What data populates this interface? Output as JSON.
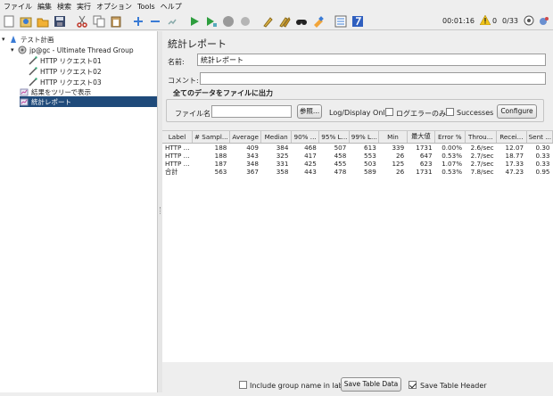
{
  "menubar": [
    "ファイル",
    "編集",
    "検索",
    "実行",
    "オプション",
    "Tools",
    "ヘルプ"
  ],
  "toolbar": {
    "icons": [
      "new-icon",
      "templates-icon",
      "open-icon",
      "save-icon",
      "cut-icon",
      "copy-icon",
      "paste-icon",
      "expand-icon",
      "collapse-icon",
      "toggle-icon",
      "start-icon",
      "start-no-pause-icon",
      "stop-icon",
      "shutdown-icon",
      "clear-icon",
      "clear-all-icon",
      "search-icon",
      "reset-search-icon",
      "function-helper-icon",
      "help-icon"
    ],
    "timer": "00:01:16",
    "warning_count": "0",
    "threads": "0/33"
  },
  "tree": {
    "items": [
      {
        "label": "テスト計画",
        "icon": "test-plan-icon",
        "level": 0,
        "expander": "▾"
      },
      {
        "label": "jp@gc - Ultimate Thread Group",
        "icon": "thread-group-icon",
        "level": 1,
        "expander": "▾"
      },
      {
        "label": "HTTP リクエスト01",
        "icon": "sampler-icon",
        "level": 2
      },
      {
        "label": "HTTP リクエスト02",
        "icon": "sampler-icon",
        "level": 2
      },
      {
        "label": "HTTP リクエスト03",
        "icon": "sampler-icon",
        "level": 2
      },
      {
        "label": "結果をツリーで表示",
        "icon": "listener-icon",
        "level": 1
      },
      {
        "label": "統計レポート",
        "icon": "listener-icon",
        "level": 1,
        "selected": true
      }
    ]
  },
  "panel": {
    "title": "統計レポート",
    "name_label": "名前:",
    "name_value": "統計レポート",
    "comment_label": "コメント:",
    "comment_value": "",
    "file_group_title": "全てのデータをファイルに出力",
    "filename_label": "ファイル名",
    "filename_value": "",
    "browse_label": "参照...",
    "log_display_label": "Log/Display Only:",
    "errors_only_label": "ログエラーのみ",
    "successes_label": "Successes",
    "configure_label": "Configure"
  },
  "table": {
    "headers": [
      "Label",
      "# Sampl...",
      "Average",
      "Median",
      "90% ...",
      "95% L...",
      "99% L...",
      "Min",
      "最大値",
      "Error %",
      "Throu...",
      "Recei...",
      "Sent ..."
    ],
    "rows": [
      [
        "HTTP ...",
        "188",
        "409",
        "384",
        "468",
        "507",
        "613",
        "339",
        "1731",
        "0.00%",
        "2.6/sec",
        "12.07",
        "0.30"
      ],
      [
        "HTTP ...",
        "188",
        "343",
        "325",
        "417",
        "458",
        "553",
        "26",
        "647",
        "0.53%",
        "2.7/sec",
        "18.77",
        "0.33"
      ],
      [
        "HTTP ...",
        "187",
        "348",
        "331",
        "425",
        "455",
        "503",
        "125",
        "623",
        "1.07%",
        "2.7/sec",
        "17.33",
        "0.33"
      ],
      [
        "合計",
        "563",
        "367",
        "358",
        "443",
        "478",
        "589",
        "26",
        "1731",
        "0.53%",
        "7.8/sec",
        "47.23",
        "0.95"
      ]
    ]
  },
  "bottom": {
    "include_group_label": "Include group name in label?",
    "include_group_checked": false,
    "save_table_data_label": "Save Table Data",
    "save_table_header_label": "Save Table Header",
    "save_table_header_checked": true
  }
}
